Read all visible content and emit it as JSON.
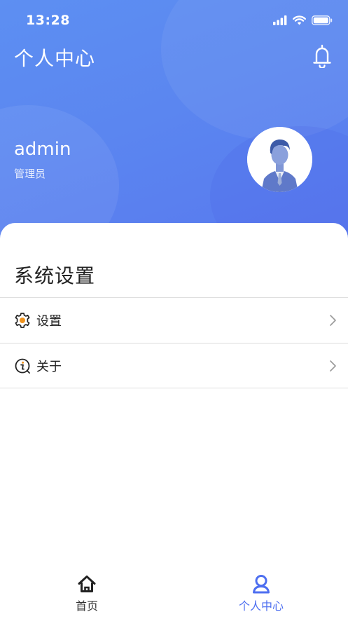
{
  "status_bar": {
    "time": "13:28"
  },
  "header": {
    "title": "个人中心"
  },
  "user": {
    "name": "admin",
    "role": "管理员"
  },
  "settings_section": {
    "title": "系统设置",
    "items": [
      {
        "label": "设置",
        "icon": "gear-icon"
      },
      {
        "label": "关于",
        "icon": "info-icon"
      }
    ]
  },
  "tabbar": {
    "tabs": [
      {
        "label": "首页",
        "icon": "home-icon",
        "active": false
      },
      {
        "label": "个人中心",
        "icon": "user-icon",
        "active": true
      }
    ]
  },
  "colors": {
    "header_gradient_start": "#5d8ff2",
    "header_gradient_end": "#5878ee",
    "accent": "#4e6ff0",
    "settings_icon": "#f0931e"
  }
}
